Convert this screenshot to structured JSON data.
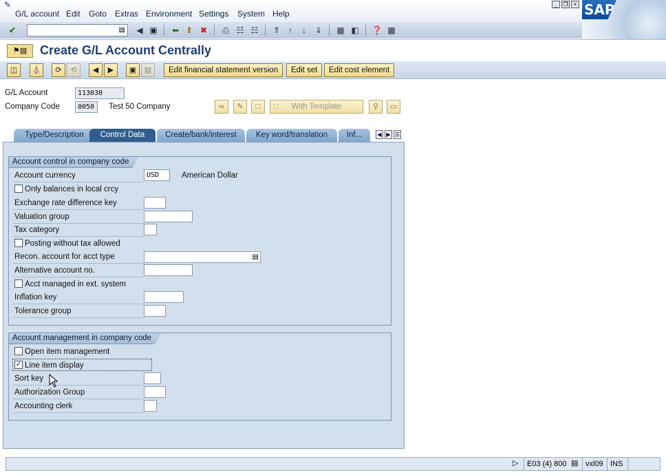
{
  "menu": {
    "items": [
      "G/L account",
      "Edit",
      "Goto",
      "Extras",
      "Environment",
      "Settings",
      "System",
      "Help"
    ]
  },
  "brand": {
    "logo_text": "SAP"
  },
  "toolbar": {
    "command_value": "",
    "icons": [
      "enter-icon",
      "back-icon",
      "save-icon",
      "green-back-icon",
      "exit-icon",
      "cancel-icon",
      "print-icon",
      "find-icon",
      "find-next-icon",
      "first-page-icon",
      "prev-page-icon",
      "next-page-icon",
      "last-page-icon",
      "new-session-icon",
      "shortcut-icon",
      "help-icon",
      "layout-icon"
    ]
  },
  "title": {
    "text": "Create G/L Account Centrally"
  },
  "app_toolbar": {
    "edit_fs_version": "Edit financial statement version",
    "edit_set": "Edit set",
    "edit_cost_element": "Edit cost element"
  },
  "header": {
    "gl_account_label": "G/L Account",
    "gl_account_value": "113030",
    "company_code_label": "Company Code",
    "company_code_value": "0050",
    "company_name": "Test 50 Company",
    "with_template": "With Template"
  },
  "tabs": [
    {
      "label": "Type/Description",
      "active": false
    },
    {
      "label": "Control Data",
      "active": true
    },
    {
      "label": "Create/bank/interest",
      "active": false
    },
    {
      "label": "Key word/translation",
      "active": false
    },
    {
      "label": "Inf...",
      "active": false
    }
  ],
  "account_control": {
    "title": "Account control in company code",
    "account_currency_label": "Account currency",
    "account_currency_value": "USD",
    "account_currency_text": "American Dollar",
    "only_balances_label": "Only balances in local crcy",
    "only_balances_checked": false,
    "exchange_rate_label": "Exchange rate difference key",
    "valuation_group_label": "Valuation group",
    "tax_category_label": "Tax category",
    "posting_without_tax_label": "Posting without tax allowed",
    "posting_without_tax_checked": false,
    "recon_account_label": "Recon. account for acct type",
    "alternative_account_label": "Alternative account no.",
    "acct_managed_label": "Acct managed in ext. system",
    "acct_managed_checked": false,
    "inflation_key_label": "Inflation key",
    "tolerance_group_label": "Tolerance group"
  },
  "account_management": {
    "title": "Account management in company code",
    "open_item_label": "Open item management",
    "open_item_checked": false,
    "line_item_label": "Line item display",
    "line_item_checked": true,
    "sort_key_label": "Sort key",
    "authorization_group_label": "Authorization Group",
    "accounting_clerk_label": "Accounting clerk"
  },
  "status": {
    "system": "E03 (4) 800",
    "server": "vxl09",
    "mode": "INS"
  },
  "colors": {
    "title_blue": "#1e3f6e",
    "active_tab": "#2f5e8e",
    "panel_bg": "#d2dfec"
  }
}
